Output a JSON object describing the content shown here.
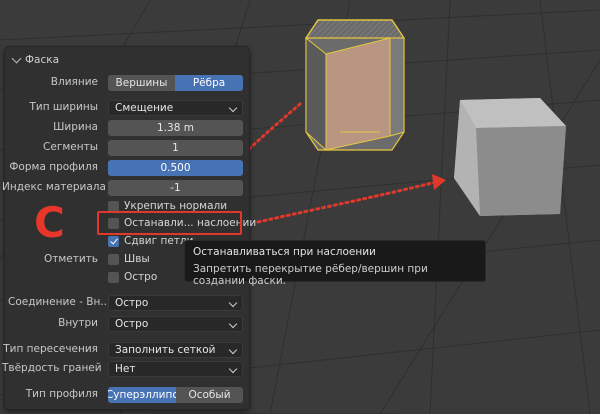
{
  "panel": {
    "title": "Фаска",
    "rows": {
      "affect": {
        "label": "Влияние",
        "options": [
          "Вершины",
          "Рёбра"
        ],
        "selected": "Рёбра"
      },
      "width_type": {
        "label": "Тип ширины",
        "value": "Смещение"
      },
      "width": {
        "label": "Ширина",
        "value": "1.38 m"
      },
      "segments": {
        "label": "Сегменты",
        "value": "1"
      },
      "profile_shape": {
        "label": "Форма профиля",
        "value": "0.500",
        "fill_fraction": 0.5
      },
      "material_index": {
        "label": "Индекс материала",
        "value": "-1"
      },
      "harden_normals": {
        "label": "Укрепить нормали",
        "checked": false
      },
      "clamp_overlap": {
        "label": "Останавли... наслоении",
        "checked": false
      },
      "loop_slide": {
        "label": "Сдвиг петли",
        "checked": true
      },
      "mark_label": "Отметить",
      "mark_seams": {
        "label": "Швы",
        "checked": false
      },
      "mark_sharp": {
        "label": "Остро",
        "checked": false
      },
      "miter_outer": {
        "label": "Соединение - Вн...",
        "value": "Остро"
      },
      "miter_inner": {
        "label": "Внутри",
        "value": "Остро"
      },
      "intersection_type": {
        "label": "Тип пересечения",
        "value": "Заполнить сеткой"
      },
      "face_strength": {
        "label": "Твёрдость граней",
        "value": "Нет"
      },
      "profile_type": {
        "label": "Тип профиля",
        "options": [
          "Суперэллипс",
          "Особый"
        ],
        "selected": "Суперэллипс"
      }
    }
  },
  "annotation": {
    "letter": "C",
    "color": "#e0392b"
  },
  "tooltip": {
    "title": "Останавливаться при наслоении",
    "description": "Запретить перекрытие рёбер/вершин при создании фаски."
  },
  "colors": {
    "accent": "#4772b3",
    "panel_bg": "#303030",
    "field_bg": "#545454"
  }
}
